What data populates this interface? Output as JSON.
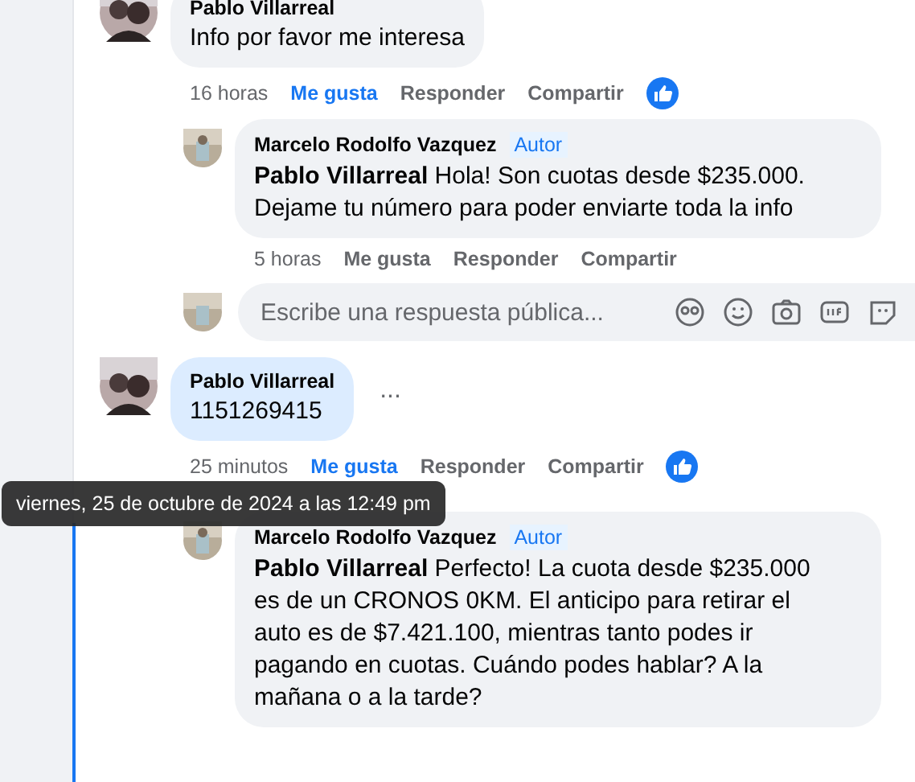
{
  "comments": [
    {
      "author": "Pablo Villarreal",
      "text": "Info por favor me interesa",
      "highlighted": false,
      "more": false,
      "time": "16 horas",
      "like_label": "Me gusta",
      "liked": true,
      "reply_label": "Responder",
      "share_label": "Compartir",
      "reaction": true,
      "replies": [
        {
          "author": "Marcelo Rodolfo Vazquez",
          "badge": "Autor",
          "text": "**Pablo Villarreal** Hola! Son cuotas desde $235.000. Dejame tu número para poder enviarte toda la info",
          "time": "5 horas",
          "like_label": "Me gusta",
          "liked": false,
          "reply_label": "Responder",
          "share_label": "Compartir"
        }
      ],
      "reply_box": {
        "placeholder": "Escribe una respuesta pública..."
      }
    },
    {
      "author": "Pablo Villarreal",
      "text": "1151269415",
      "highlighted": true,
      "more": true,
      "more_label": "...",
      "time": "25 minutos",
      "like_label": "Me gusta",
      "liked": true,
      "reply_label": "Responder",
      "share_label": "Compartir",
      "reaction": true,
      "replies": [
        {
          "author": "Marcelo Rodolfo Vazquez",
          "badge": "Autor",
          "text": "**Pablo Villarreal** Perfecto! La cuota desde $235.000 es de un CRONOS 0KM. El anticipo para retirar el auto es de $7.421.100, mientras tanto podes ir pagando en cuotas. Cuándo podes hablar? A la mañana o a la tarde?"
        }
      ],
      "tooltip": "viernes, 25 de octubre de 2024 a las 12:49 pm"
    }
  ]
}
